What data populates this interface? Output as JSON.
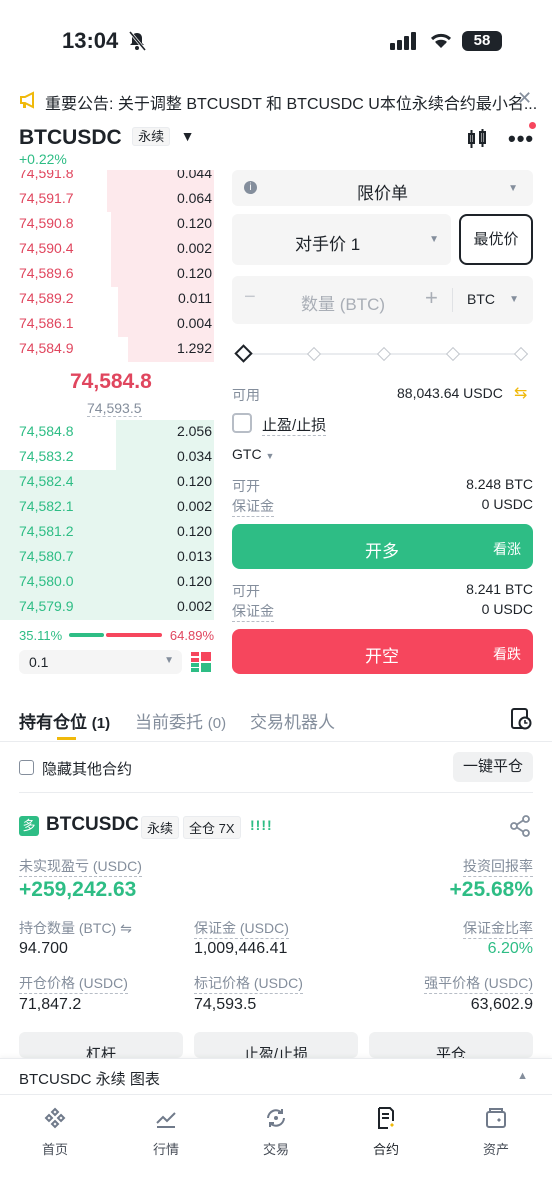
{
  "status_bar": {
    "time": "13:04",
    "battery": "58"
  },
  "announcement": {
    "text": "重要公告: 关于调整 BTCUSDT 和 BTCUSDC U本位永续合约最小名..."
  },
  "header": {
    "symbol": "BTCUSDC",
    "tag": "永续",
    "change": "+0.22%"
  },
  "order_book": {
    "asks": [
      {
        "price": "74,591.8",
        "qty": "0.044",
        "depth": 0.5
      },
      {
        "price": "74,591.7",
        "qty": "0.064",
        "depth": 0.5
      },
      {
        "price": "74,590.8",
        "qty": "0.120",
        "depth": 0.48
      },
      {
        "price": "74,590.4",
        "qty": "0.002",
        "depth": 0.48
      },
      {
        "price": "74,589.6",
        "qty": "0.120",
        "depth": 0.48
      },
      {
        "price": "74,589.2",
        "qty": "0.011",
        "depth": 0.45
      },
      {
        "price": "74,586.1",
        "qty": "0.004",
        "depth": 0.45
      },
      {
        "price": "74,584.9",
        "qty": "1.292",
        "depth": 0.4
      }
    ],
    "last_price": "74,584.8",
    "mark_price": "74,593.5",
    "bids": [
      {
        "price": "74,584.8",
        "qty": "2.056",
        "depth": 0.46
      },
      {
        "price": "74,583.2",
        "qty": "0.034",
        "depth": 0.46
      },
      {
        "price": "74,582.4",
        "qty": "0.120",
        "depth": 1.0
      },
      {
        "price": "74,582.1",
        "qty": "0.002",
        "depth": 1.0
      },
      {
        "price": "74,581.2",
        "qty": "0.120",
        "depth": 1.0
      },
      {
        "price": "74,580.7",
        "qty": "0.013",
        "depth": 1.0
      },
      {
        "price": "74,580.0",
        "qty": "0.120",
        "depth": 1.0
      },
      {
        "price": "74,579.9",
        "qty": "0.002",
        "depth": 1.0
      }
    ],
    "buy_ratio": "35.11%",
    "sell_ratio": "64.89%",
    "precision": "0.1"
  },
  "order_form": {
    "order_type": "限价单",
    "price_mode": "对手价 1",
    "best_price": "最优价",
    "qty_placeholder": "数量 (BTC)",
    "qty_unit": "BTC",
    "available_label": "可用",
    "available_value": "88,043.64 USDC",
    "tpsl_label": "止盈/止损",
    "tif": "GTC",
    "long": {
      "open_label": "可开",
      "open_value": "8.248 BTC",
      "margin_label": "保证金",
      "margin_value": "0 USDC",
      "button": "开多",
      "hint": "看涨"
    },
    "short": {
      "open_label": "可开",
      "open_value": "8.241 BTC",
      "margin_label": "保证金",
      "margin_value": "0 USDC",
      "button": "开空",
      "hint": "看跌"
    }
  },
  "tabs": {
    "positions": "持有仓位",
    "positions_count": "(1)",
    "orders": "当前委托",
    "orders_count": "(0)",
    "bots": "交易机器人"
  },
  "positions_bar": {
    "hide_label": "隐藏其他合约",
    "close_all": "一键平仓"
  },
  "position": {
    "side_badge": "多",
    "symbol": "BTCUSDC",
    "tag": "永续",
    "margin_mode": "全仓 7X",
    "signal": "!!!!",
    "pnl_label": "未实现盈亏 (USDC)",
    "pnl_value": "+259,242.63",
    "roe_label": "投资回报率",
    "roe_value": "+25.68%",
    "size_label": "持仓数量 (BTC)",
    "size_value": "94.700",
    "margin_label": "保证金 (USDC)",
    "margin_value": "1,009,446.41",
    "margin_ratio_label": "保证金比率",
    "margin_ratio_value": "6.20%",
    "entry_label": "开仓价格 (USDC)",
    "entry_value": "71,847.2",
    "mark_label": "标记价格 (USDC)",
    "mark_value": "74,593.5",
    "liq_label": "强平价格 (USDC)",
    "liq_value": "63,602.9",
    "btn_leverage": "杠杆",
    "btn_tpsl": "止盈/止损",
    "btn_close": "平仓"
  },
  "chart_bar": {
    "label": "BTCUSDC 永续 图表"
  },
  "bottom_nav": [
    {
      "label": "首页",
      "icon": "home-icon"
    },
    {
      "label": "行情",
      "icon": "markets-icon"
    },
    {
      "label": "交易",
      "icon": "trade-icon"
    },
    {
      "label": "合约",
      "icon": "futures-icon"
    },
    {
      "label": "资产",
      "icon": "wallet-icon"
    }
  ],
  "colors": {
    "green": "#2ebd85",
    "red": "#f6465d",
    "accent": "#f0b90b"
  }
}
